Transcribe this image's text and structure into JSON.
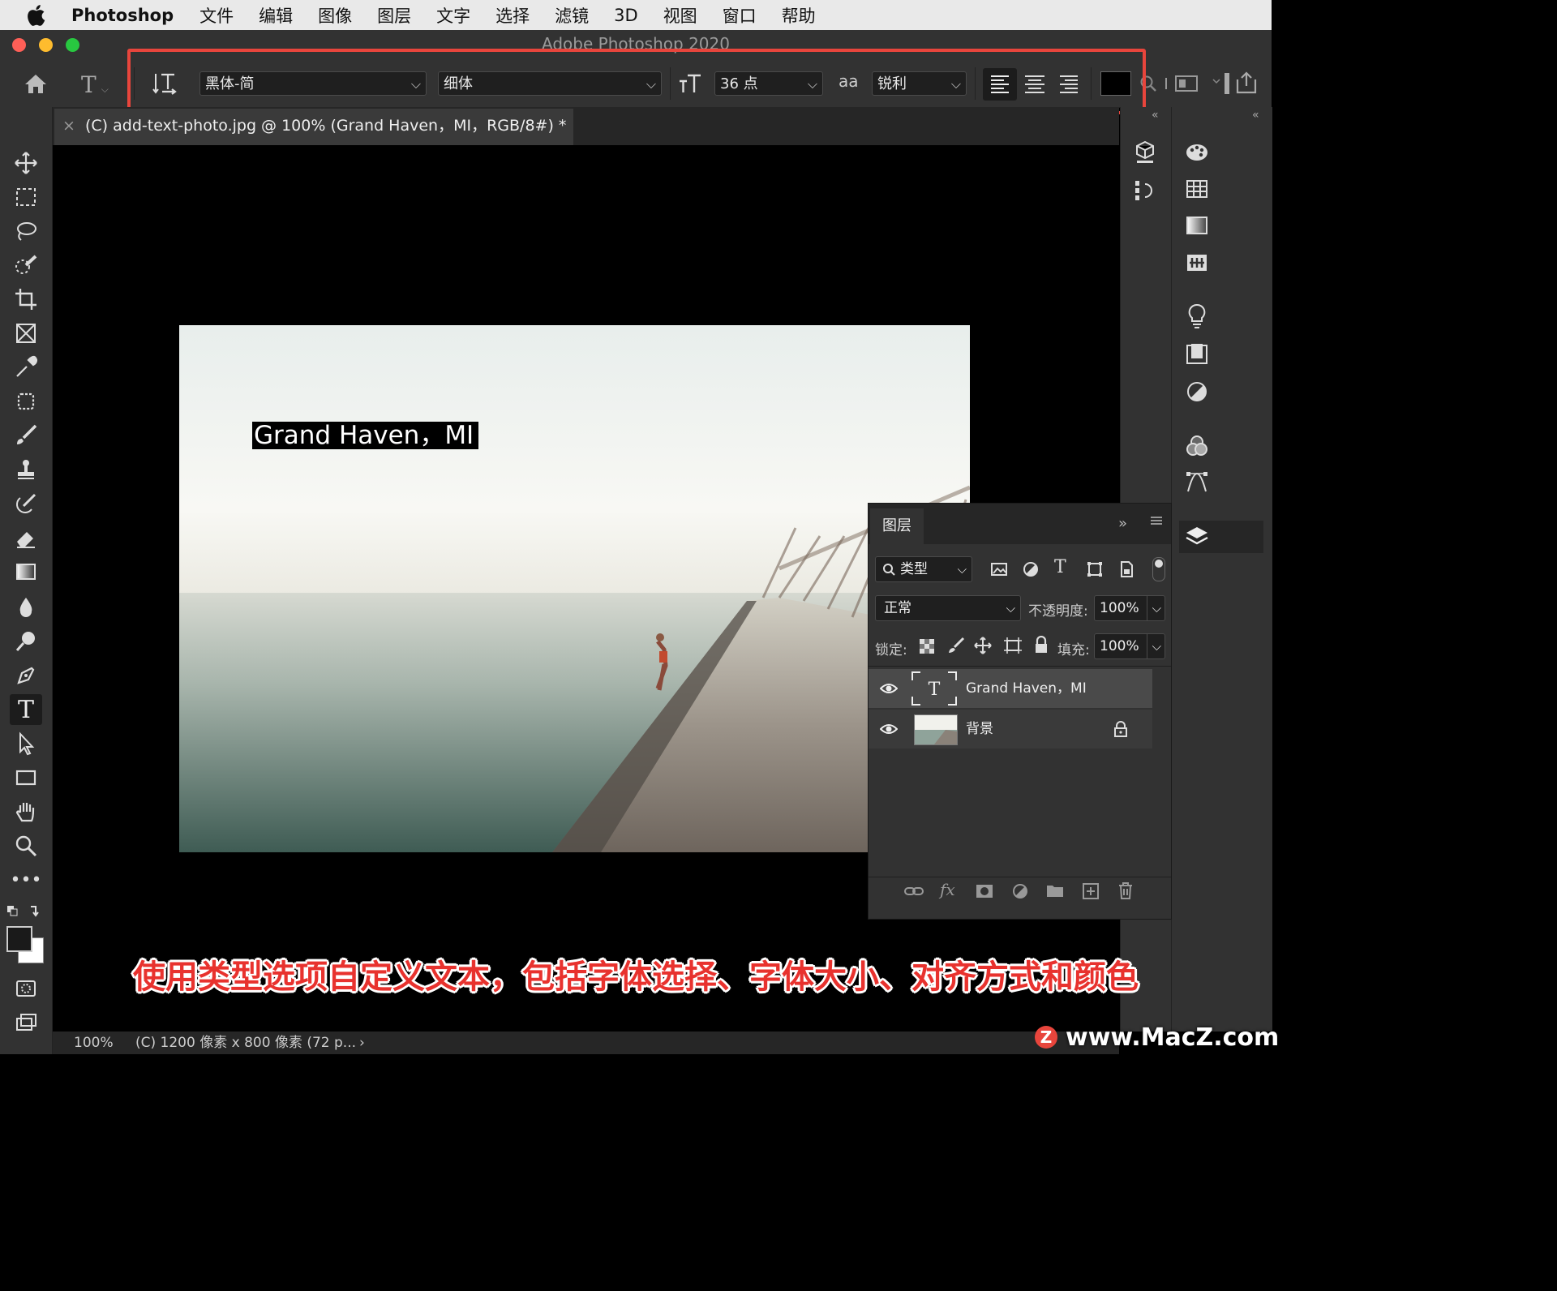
{
  "menubar": {
    "app_name": "Photoshop",
    "items": [
      "文件",
      "编辑",
      "图像",
      "图层",
      "文字",
      "选择",
      "滤镜",
      "3D",
      "视图",
      "窗口",
      "帮助"
    ]
  },
  "window": {
    "title": "Adobe Photoshop 2020"
  },
  "options_bar": {
    "font_family": "黑体-简",
    "font_style": "细体",
    "font_size": "36 点",
    "antialias_icon_label": "aa",
    "antialias": "锐利",
    "text_color": "#000000"
  },
  "document": {
    "tab_title": "(C) add-text-photo.jpg @ 100% (Grand Haven，MI，RGB/8#) *",
    "text_layer_content": "Grand Haven，MI"
  },
  "layers_panel": {
    "tab_label": "图层",
    "filter_kind": "类型",
    "blend_mode": "正常",
    "opacity_label": "不透明度:",
    "opacity_value": "100%",
    "lock_label": "锁定:",
    "fill_label": "填充:",
    "fill_value": "100%",
    "layers": [
      {
        "name": "Grand Haven，MI",
        "kind": "text",
        "visible": true,
        "selected": true
      },
      {
        "name": "背景",
        "kind": "image",
        "visible": true,
        "locked": true
      }
    ]
  },
  "status_bar": {
    "zoom": "100%",
    "doc_info": "(C) 1200 像素 x 800 像素 (72 p..."
  },
  "caption": "使用类型选项自定义文本，包括字体选择、字体大小、对齐方式和颜色",
  "watermark": "www.MacZ.com",
  "colors": {
    "highlight": "#e8453c",
    "panel": "#323232",
    "caption": "#e8322e"
  }
}
